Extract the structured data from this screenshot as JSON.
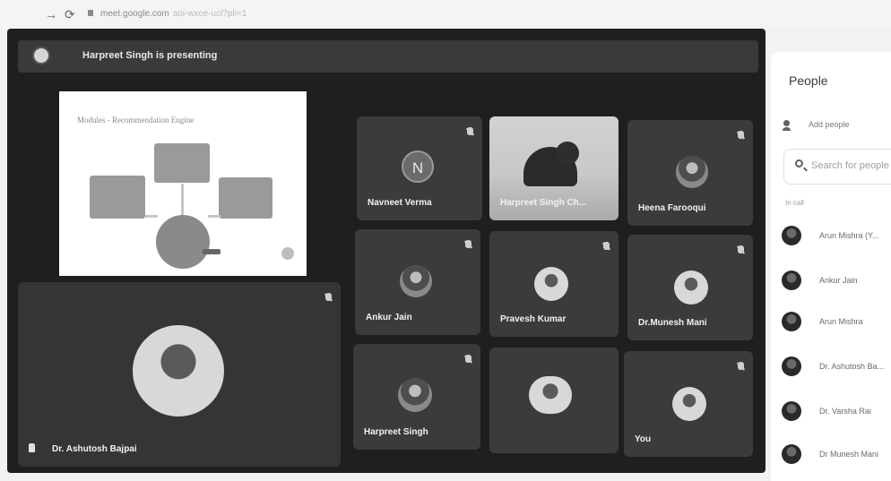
{
  "browser": {
    "url": "meet.google.com",
    "url_suffix": "aoi-wxce-ucl?pli=1"
  },
  "banner": {
    "presenting_text": "Harpreet Singh is presenting"
  },
  "slide": {
    "title": "Modules - Recommendation Engine"
  },
  "tiles": [
    {
      "name": "Navneet Verma",
      "initial": "N"
    },
    {
      "name": "Harpreet Singh Ch..."
    },
    {
      "name": "Heena Farooqui"
    },
    {
      "name": "Ankur Jain"
    },
    {
      "name": "Pravesh Kumar"
    },
    {
      "name": "Dr.Munesh Mani"
    },
    {
      "name": "Harpreet Singh"
    },
    {
      "name": ""
    },
    {
      "name": "You"
    },
    {
      "name": "Dr. Ashutosh Bajpai"
    }
  ],
  "people_panel": {
    "title": "People",
    "add_people": "Add people",
    "search_placeholder": "Search for people",
    "section": "In call",
    "people": [
      {
        "name": "Arun Mishra (Y..."
      },
      {
        "name": "Ankur Jain"
      },
      {
        "name": "Arun Mishra"
      },
      {
        "name": "Dr. Ashutosh Ba..."
      },
      {
        "name": "Dr. Varsha Rai"
      },
      {
        "name": "Dr Munesh Mani"
      }
    ]
  }
}
